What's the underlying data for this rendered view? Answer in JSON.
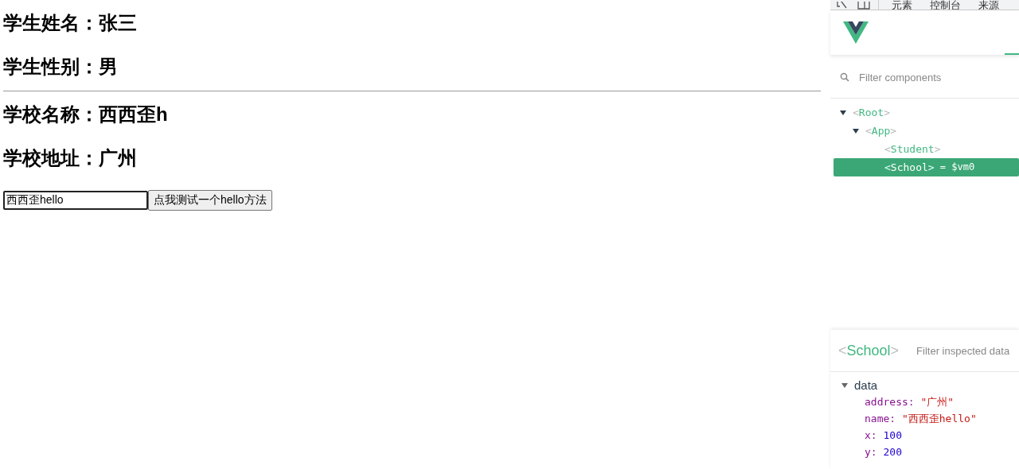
{
  "page": {
    "student": [
      {
        "text": "学生姓名：张三"
      },
      {
        "text": "学生性别：男"
      }
    ],
    "school": [
      {
        "text": "学校名称：西西歪h"
      },
      {
        "text": "学校地址：广州"
      }
    ],
    "input": {
      "value": "西西歪hello"
    },
    "button": {
      "label": "点我测试一个hello方法"
    }
  },
  "devtools": {
    "tabs": [
      {
        "label": "元素",
        "selected": false
      },
      {
        "label": "控制台",
        "selected": false
      },
      {
        "label": "来源",
        "selected": false
      }
    ],
    "filter": {
      "placeholder": "Filter components"
    },
    "tree": [
      {
        "name": "<Root>",
        "expanded": true,
        "selected": false,
        "children": [
          {
            "name": "<App>",
            "expanded": true,
            "selected": false,
            "children": [
              {
                "name": "<Student>",
                "selected": false
              },
              {
                "name": "<School>",
                "selected": true,
                "suffix": "= $vm0"
              }
            ]
          }
        ]
      }
    ],
    "inspector": {
      "component": "<School>",
      "filter_placeholder": "Filter inspected data",
      "section": "data",
      "expanded": true,
      "props": [
        {
          "key": "address:",
          "value": "\"广州\"",
          "kind": "string"
        },
        {
          "key": "name:",
          "value": "\"西西歪hello\"",
          "kind": "string"
        },
        {
          "key": "x:",
          "value": "100",
          "kind": "number"
        },
        {
          "key": "y:",
          "value": "200",
          "kind": "number"
        }
      ]
    }
  }
}
